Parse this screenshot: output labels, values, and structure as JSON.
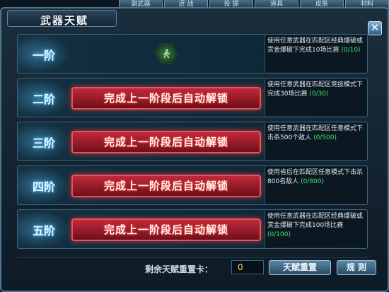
{
  "top_tabs": [
    "副武器",
    "近 战",
    "投 掷",
    "道具",
    "皮肤",
    "材料"
  ],
  "window": {
    "title": "武器天赋",
    "close_symbol": "✕"
  },
  "tiers": [
    {
      "label": "一阶",
      "locked": false,
      "lock_text": "",
      "desc": "使用任意武器在匹配区经典爆破或赏金爆破下完成10场比赛",
      "progress": "(0/10)"
    },
    {
      "label": "二阶",
      "locked": true,
      "lock_text": "完成上一阶段后自动解锁",
      "desc": "使用任意武器在匹配区竞技模式下完成30场比赛",
      "progress": "(0/30)"
    },
    {
      "label": "三阶",
      "locked": true,
      "lock_text": "完成上一阶段后自动解锁",
      "desc": "使用任意武器在匹配区任意模式下击杀500个敌人",
      "progress": "(0/500)"
    },
    {
      "label": "四阶",
      "locked": true,
      "lock_text": "完成上一阶段后自动解锁",
      "desc": "使用省后在匹配区任意模式下击杀800名敌人",
      "progress": "(0/800)"
    },
    {
      "label": "五阶",
      "locked": true,
      "lock_text": "完成上一阶段后自动解锁",
      "desc": "使用任意武器在匹配区经典爆破或赏金爆破下完成100场比赛",
      "progress": "(0/100)"
    }
  ],
  "footer": {
    "reset_label": "剩余天赋重置卡：",
    "reset_count": "0",
    "reset_button": "天赋重置",
    "rules_button": "规 则"
  },
  "colors": {
    "accent": "#5cc6ff",
    "lock_red": "#c0293a",
    "progress_green": "#3fe36a"
  }
}
